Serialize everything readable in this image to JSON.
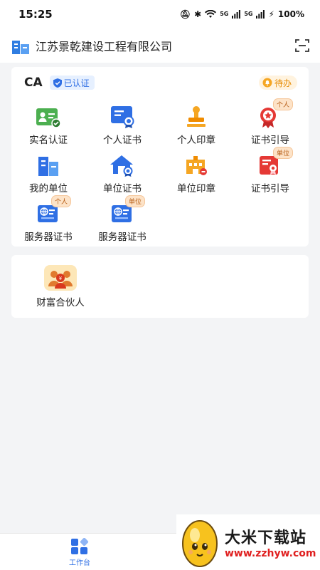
{
  "status_bar": {
    "time": "15:25",
    "battery": "100%",
    "sig1": "5G",
    "sig2": "5G"
  },
  "header": {
    "title": "江苏景乾建设工程有限公司"
  },
  "ca_section": {
    "title": "CA",
    "verified_label": "已认证",
    "todo_label": "待办",
    "items": [
      {
        "label": "实名认证",
        "icon": "id-card-check-icon"
      },
      {
        "label": "个人证书",
        "icon": "personal-certificate-icon"
      },
      {
        "label": "个人印章",
        "icon": "personal-seal-icon"
      },
      {
        "label": "证书引导",
        "icon": "certificate-guide-icon",
        "tag": "个人"
      },
      {
        "label": "我的单位",
        "icon": "organization-building-icon"
      },
      {
        "label": "单位证书",
        "icon": "organization-certificate-icon"
      },
      {
        "label": "单位印章",
        "icon": "organization-seal-icon"
      },
      {
        "label": "证书引导",
        "icon": "certificate-guide-icon",
        "tag": "单位"
      },
      {
        "label": "服务器证书",
        "icon": "server-certificate-icon",
        "tag": "个人"
      },
      {
        "label": "服务器证书",
        "icon": "server-certificate-icon",
        "tag": "单位"
      }
    ]
  },
  "partner_section": {
    "label": "财富合伙人",
    "icon": "wealth-partner-icon"
  },
  "tab_bar": {
    "workbench_label": "工作台"
  },
  "watermark": {
    "title": "大米下载站",
    "url": "www.zzhyw.com"
  },
  "colors": {
    "primary": "#2f6fe4",
    "orange": "#f5a623",
    "green": "#4caf50",
    "red": "#e53935"
  }
}
